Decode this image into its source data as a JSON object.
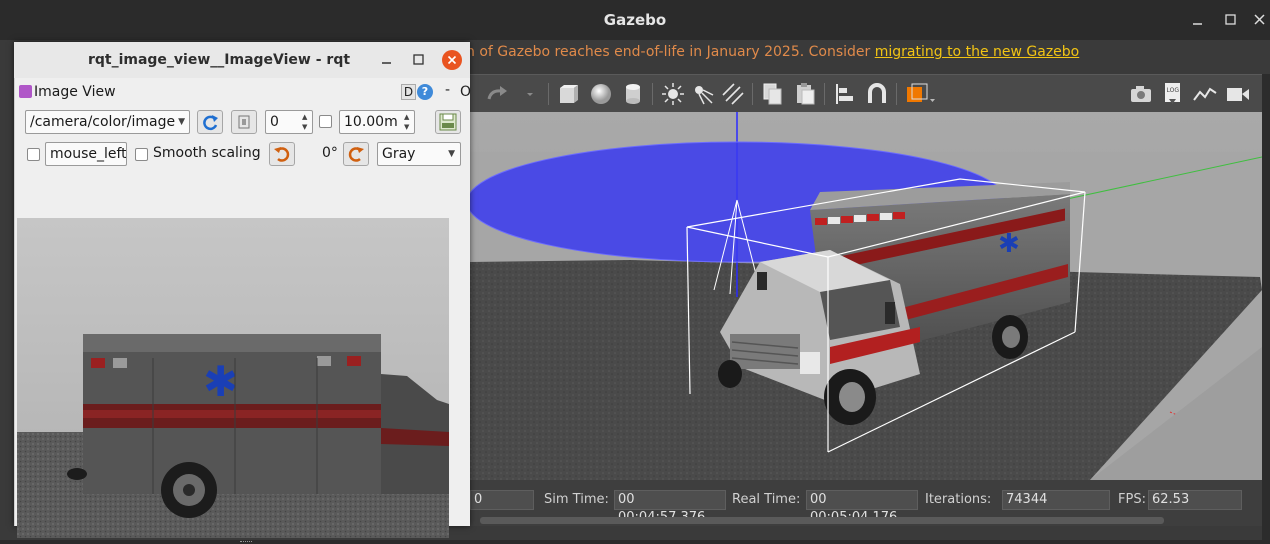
{
  "gazebo": {
    "title": "Gazebo",
    "banner_text": "n of Gazebo reaches end-of-life in January 2025. Consider ",
    "banner_link": "migrating to the new Gazebo",
    "status": {
      "sim_time_label": "Sim Time:",
      "sim_time_value": "00 00:04:57.376",
      "real_time_label": "Real Time:",
      "real_time_value": "00 00:05:04.176",
      "iterations_label": "Iterations:",
      "iterations_value": "74344",
      "fps_label": "FPS:",
      "fps_value": "62.53",
      "left_partial_value": "0"
    },
    "colors": {
      "banner_text": "#e08a4a",
      "banner_link": "#f2c414",
      "laser": "#2a2aff"
    }
  },
  "rqt": {
    "title": "rqt_image_view__ImageView - rqt",
    "plugin_title": "Image View",
    "d_label": "D",
    "help_label": "?",
    "dash_label": "-",
    "o_label": "O",
    "topic_value": "/camera/color/image",
    "spin_value": "0",
    "max_range_value": "10.00m",
    "mouse_field_value": "mouse_left",
    "smooth_scaling_label": "Smooth scaling",
    "rotation_label": "0°",
    "color_scheme_value": "Gray"
  }
}
